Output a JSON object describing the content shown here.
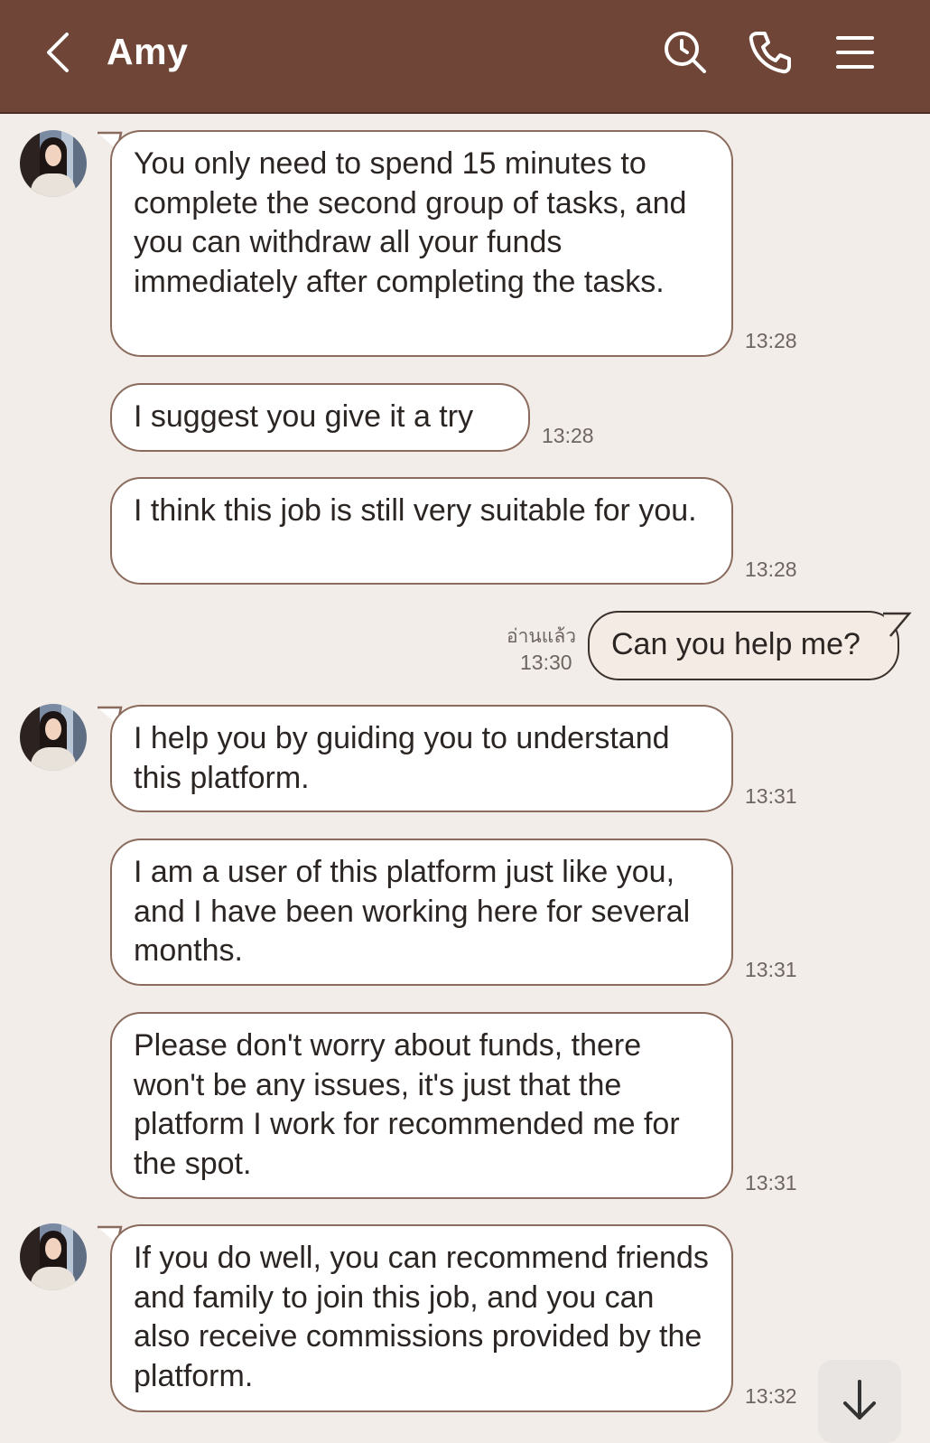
{
  "header": {
    "title": "Amy",
    "back_icon": "chevron-left-icon",
    "search_icon": "search-icon",
    "call_icon": "phone-icon",
    "menu_icon": "menu-icon",
    "background": "#6e4536"
  },
  "messages": [
    {
      "side": "in",
      "text": "You only need to spend 15 minutes to complete the second group of tasks, and you can withdraw all your funds immediately after completing the tasks.",
      "time": "13:28"
    },
    {
      "side": "in",
      "text": "I suggest you give it a try",
      "time": "13:28"
    },
    {
      "side": "in",
      "text": "I think this job is still very suitable for you.",
      "time": "13:28"
    },
    {
      "side": "out",
      "text": "Can you help me?",
      "read_label": "อ่านแล้ว",
      "time": "13:30"
    },
    {
      "side": "in",
      "text": "I help you by guiding you to understand this platform.",
      "time": "13:31"
    },
    {
      "side": "in",
      "text": "I am a user of this platform just like you, and I have been working here for several months.",
      "time": "13:31"
    },
    {
      "side": "in",
      "text": "Please don't worry about funds, there won't be any issues, it's just that the platform I work for recommended me for the spot.",
      "time": "13:31"
    },
    {
      "side": "in",
      "text": "If you do well, you can recommend friends and family to join this job, and you can also receive commissions provided by the platform.",
      "time": "13:32"
    }
  ],
  "scroll_down_icon": "arrow-down-icon"
}
